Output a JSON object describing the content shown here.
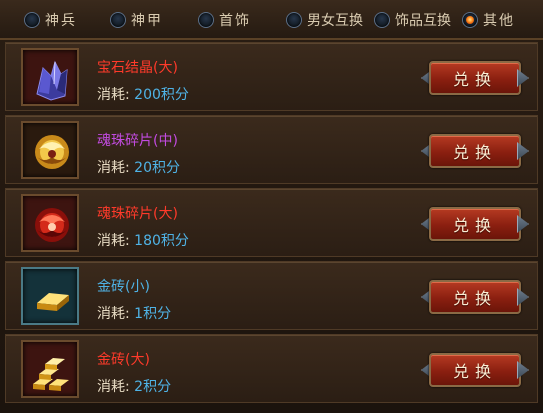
{
  "tabs": [
    {
      "label": "神兵",
      "checked": false
    },
    {
      "label": "神甲",
      "checked": false
    },
    {
      "label": "首饰",
      "checked": false
    },
    {
      "label": "男女互换",
      "checked": false
    },
    {
      "label": "饰品互换",
      "checked": false
    },
    {
      "label": "其他",
      "checked": true
    }
  ],
  "cost_prefix": "消耗:",
  "redeem_label": "兑换",
  "items": [
    {
      "name": "宝石结晶(大)",
      "name_color": "#ff3a2a",
      "cost_value": "200积分",
      "icon": "crystal-icon"
    },
    {
      "name": "魂珠碎片(中)",
      "name_color": "#c24be0",
      "cost_value": "20积分",
      "icon": "soul-orb-gold-icon"
    },
    {
      "name": "魂珠碎片(大)",
      "name_color": "#ff3a2a",
      "cost_value": "180积分",
      "icon": "soul-orb-red-icon"
    },
    {
      "name": "金砖(小)",
      "name_color": "#4fb3e6",
      "cost_value": "1积分",
      "icon": "gold-bar-icon"
    },
    {
      "name": "金砖(大)",
      "name_color": "#ff3a2a",
      "cost_value": "2积分",
      "icon": "gold-bars-stack-icon"
    }
  ]
}
